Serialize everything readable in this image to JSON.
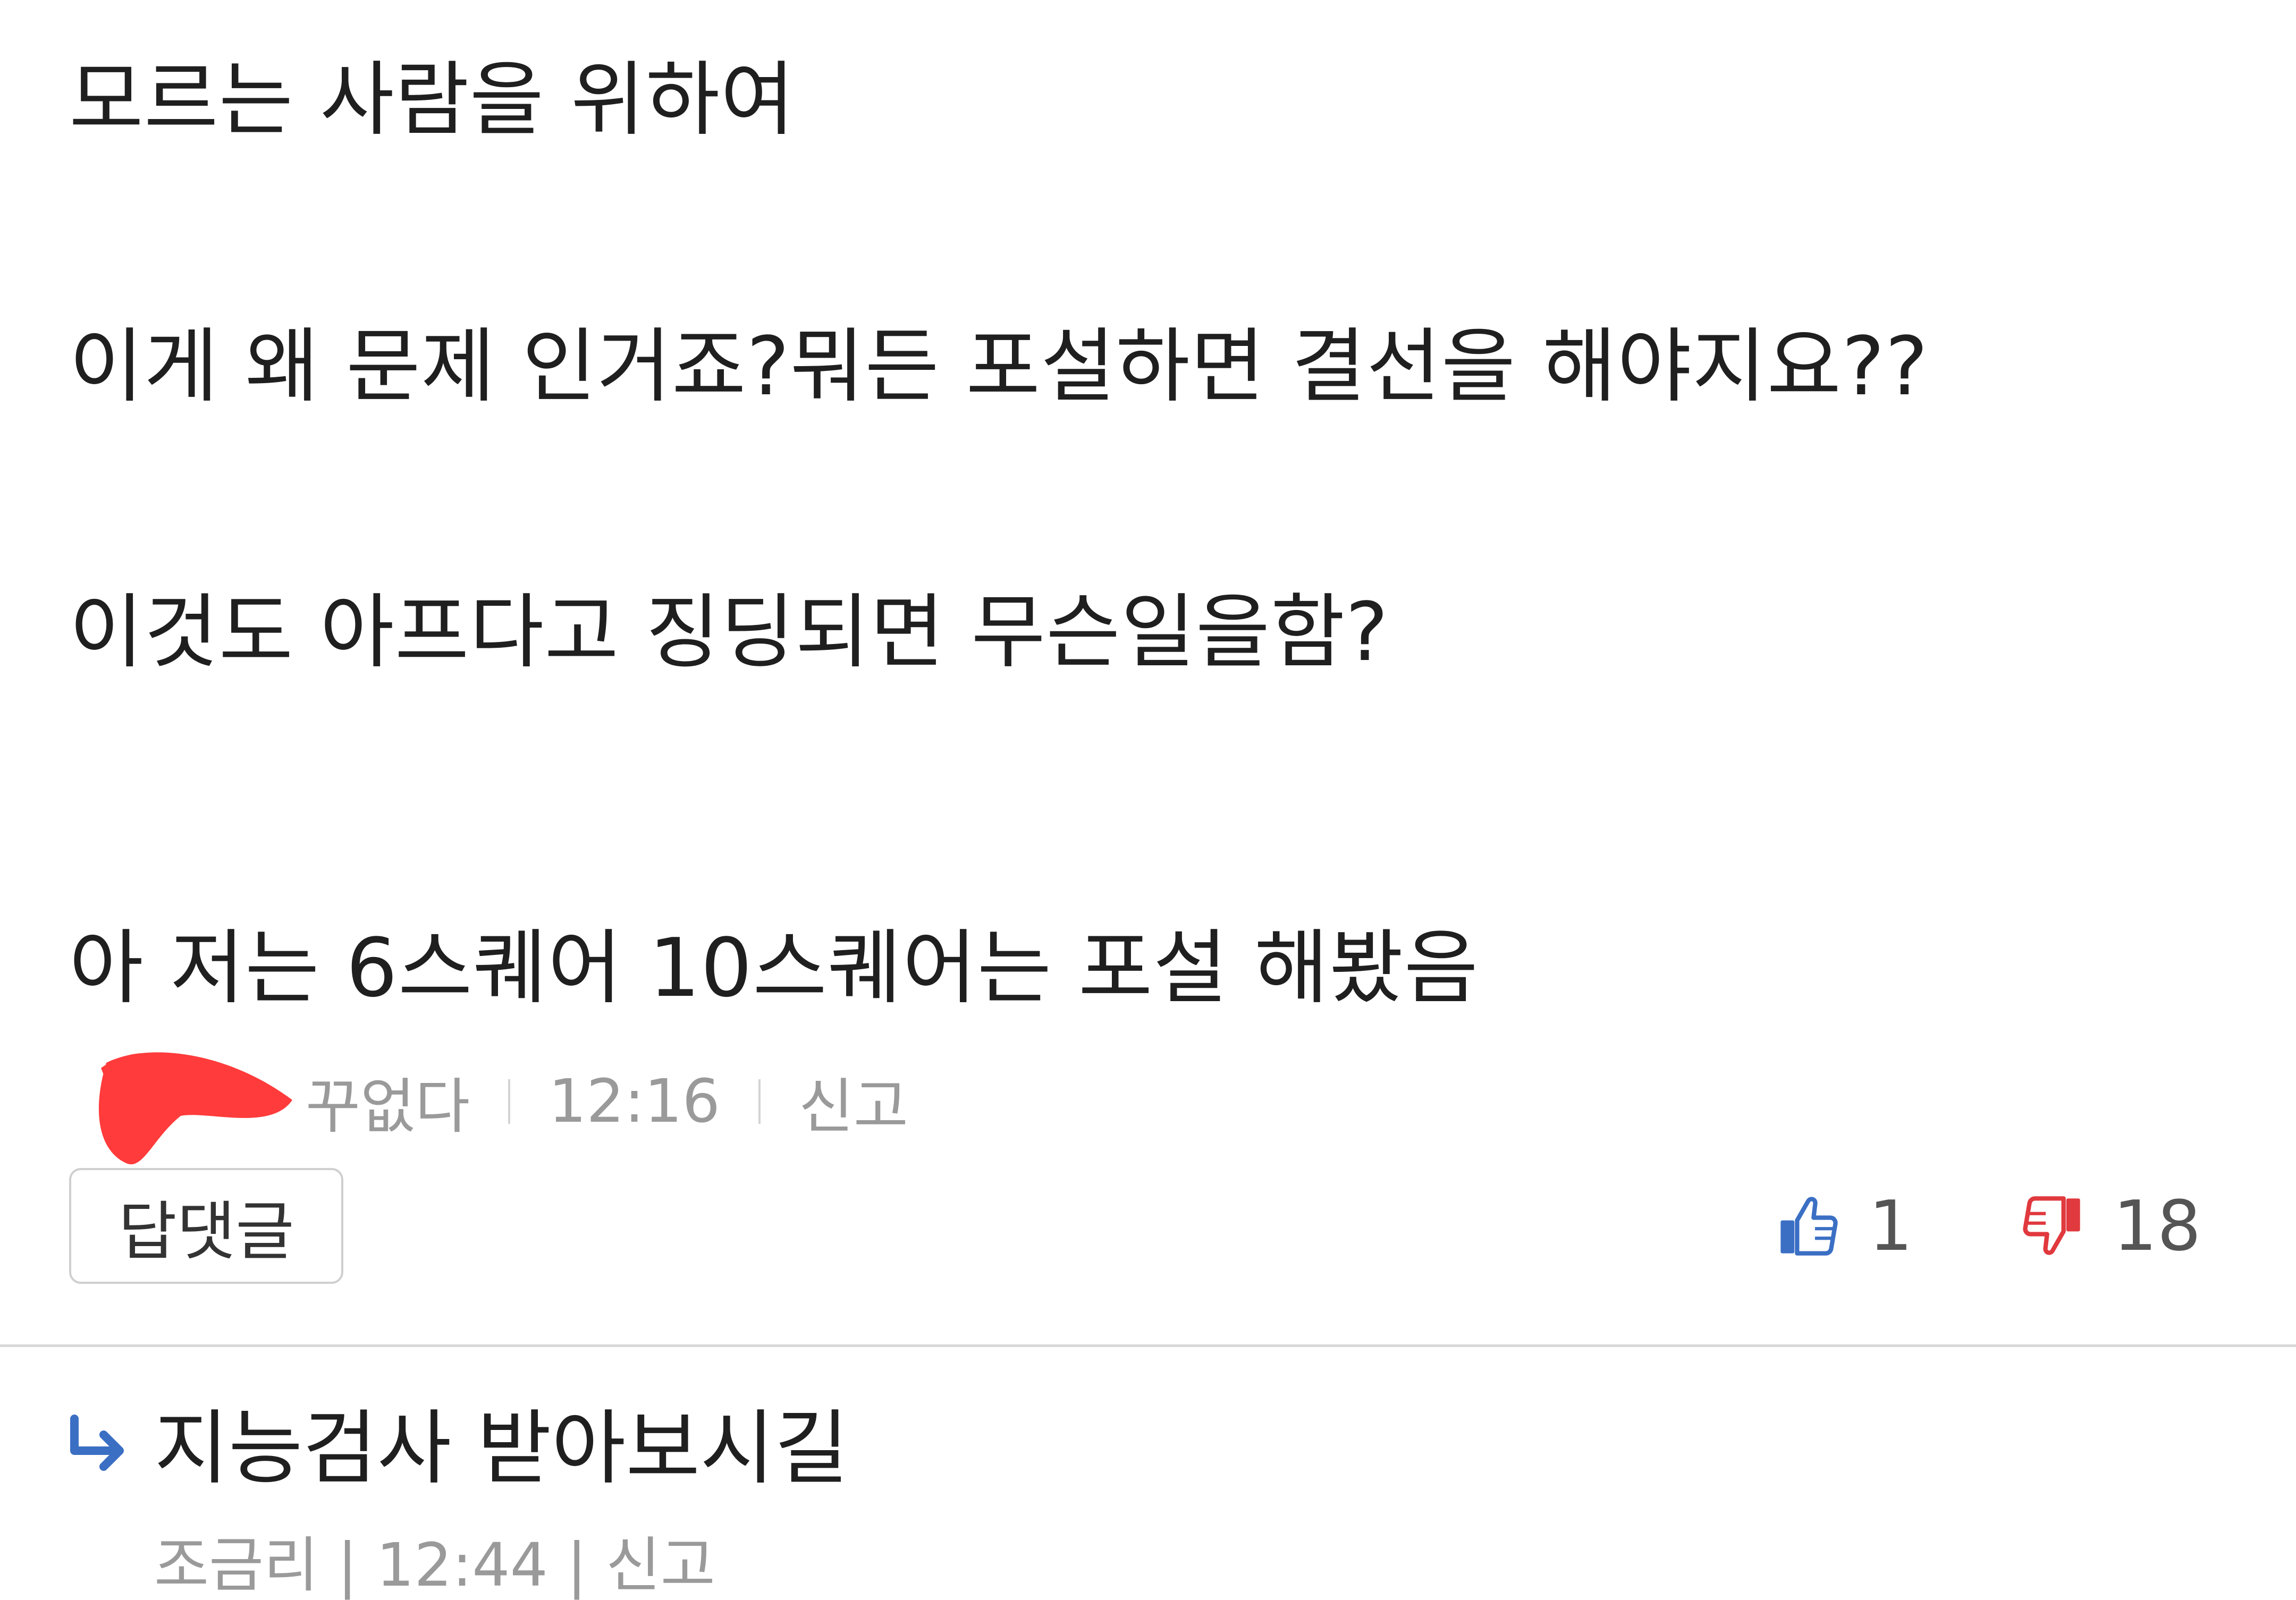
{
  "comment": {
    "lines": [
      "모르는 사람을 위하여",
      "이게 왜 문제 인거죠?뭐든 포설하면 결선을 해야지요??",
      "이것도 아프다고 징딩되면 무슨일을함?",
      "아 저는 6스퀘어 10스퀘어는 포설 해봤음"
    ],
    "author_visible_fragment": "꾸없다",
    "time": "12:16",
    "report_label": "신고",
    "reply_button_label": "답댓글",
    "likes": "1",
    "dislikes": "18",
    "colors": {
      "like": "#3b6fc4",
      "dislike": "#e0393e",
      "redaction": "#ff3b3b"
    }
  },
  "reply": {
    "text": "지능검사 받아보시길",
    "meta_partial": "조금리 | 12:44 | 신고"
  }
}
